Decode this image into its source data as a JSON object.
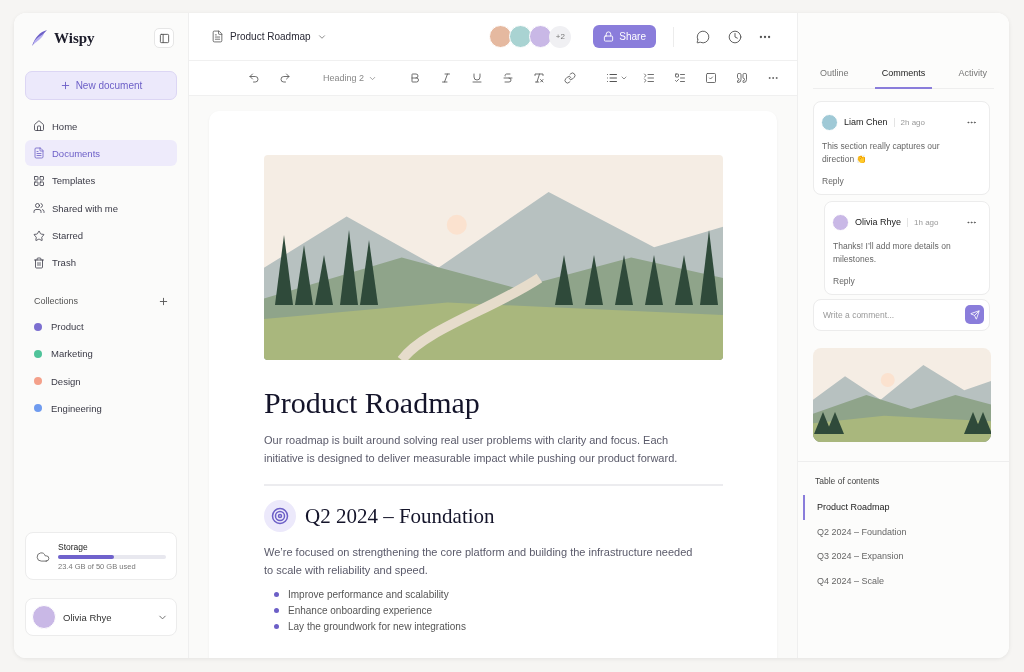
{
  "sidebar": {
    "brand": "Wispy",
    "new_button": "New document",
    "nav": [
      {
        "label": "Home",
        "selected": false
      },
      {
        "label": "Documents",
        "selected": true
      },
      {
        "label": "Templates",
        "selected": false
      },
      {
        "label": "Shared with me",
        "selected": false
      },
      {
        "label": "Starred",
        "selected": false
      },
      {
        "label": "Trash",
        "selected": false
      }
    ],
    "collections_title": "Collections",
    "collections": [
      {
        "label": "Product",
        "color": "#7c6fd0"
      },
      {
        "label": "Marketing",
        "color": "#4fc39a"
      },
      {
        "label": "Design",
        "color": "#f4a08a"
      },
      {
        "label": "Engineering",
        "color": "#6f9bef"
      }
    ],
    "storage": {
      "title": "Storage",
      "level": 0.52,
      "usage": "23.4 GB of 50 GB used"
    },
    "user": {
      "name": "Olivia Rhye"
    }
  },
  "topbar": {
    "doc_title": "Product Roadmap",
    "extra_collaborators": "+2",
    "share": "Share"
  },
  "toolbar": {
    "heading_select": "Heading 2"
  },
  "document": {
    "title": "Product Roadmap",
    "intro": "Our roadmap is built around solving real user problems with clarity and focus. Each initiative is designed to deliver measurable impact while pushing our product forward.",
    "sections": [
      {
        "heading": "Q2 2024 – Foundation",
        "text": "We’re focused on strengthening the core platform and building the infrastructure needed to scale with reliability and speed.",
        "bullets": [
          "Improve performance and scalability",
          "Enhance onboarding experience",
          "Lay the groundwork for new integrations"
        ]
      }
    ]
  },
  "panel": {
    "tabs": [
      {
        "label": "Outline",
        "selected": false
      },
      {
        "label": "Comments",
        "selected": true
      },
      {
        "label": "Activity",
        "selected": false
      }
    ],
    "comments": [
      {
        "author": "Liam Chen",
        "time": "2h ago",
        "text": "This section really captures our direction 👏",
        "reply": "Reply",
        "replies": [
          {
            "author": "Olivia Rhye",
            "time": "1h ago",
            "text": "Thanks! I’ll add more details on milestones.",
            "reply": "Reply"
          }
        ]
      }
    ],
    "comment_placeholder": "Write a comment...",
    "toc_title": "Table of contents",
    "toc": [
      {
        "label": "Product Roadmap",
        "selected": true
      },
      {
        "label": "Q2 2024 – Foundation",
        "selected": false
      },
      {
        "label": "Q3 2024 – Expansion",
        "selected": false
      },
      {
        "label": "Q4 2024 – Scale",
        "selected": false
      }
    ]
  }
}
